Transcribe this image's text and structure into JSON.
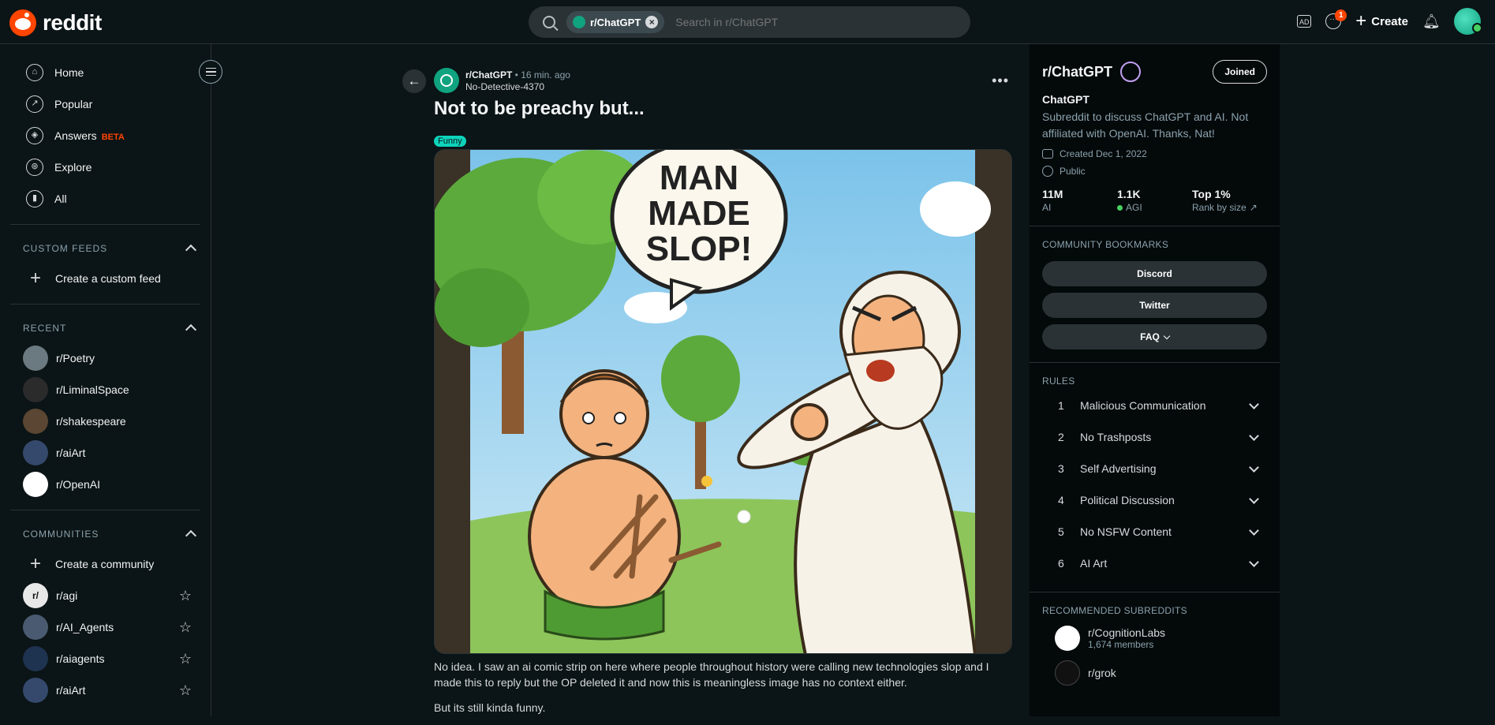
{
  "app": {
    "logo_text": "reddit",
    "brand_color": "#ff4500"
  },
  "search": {
    "chip_label": "r/ChatGPT",
    "placeholder": "Search in r/ChatGPT"
  },
  "header": {
    "notification_count": "1",
    "create_label": "Create",
    "icons": [
      "advertise-icon",
      "chat-icon",
      "plus-icon",
      "bell-icon",
      "avatar"
    ]
  },
  "sidebar": {
    "nav": [
      {
        "label": "Home",
        "icon": "home-icon"
      },
      {
        "label": "Popular",
        "icon": "popular-icon"
      },
      {
        "label": "Answers",
        "badge": "BETA",
        "icon": "answers-icon"
      },
      {
        "label": "Explore",
        "icon": "explore-icon"
      },
      {
        "label": "All",
        "icon": "all-icon"
      }
    ],
    "custom_feeds": {
      "title": "CUSTOM FEEDS",
      "create_label": "Create a custom feed"
    },
    "recent": {
      "title": "RECENT",
      "items": [
        "r/Poetry",
        "r/LiminalSpace",
        "r/shakespeare",
        "r/aiArt",
        "r/OpenAI"
      ]
    },
    "communities": {
      "title": "COMMUNITIES",
      "create_label": "Create a community",
      "items": [
        "r/agi",
        "r/AI_Agents",
        "r/aiagents",
        "r/aiArt"
      ]
    }
  },
  "post": {
    "subreddit": "r/ChatGPT",
    "time": "16 min. ago",
    "author": "No-Detective-4370",
    "title": "Not to be preachy but...",
    "flair": "Funny",
    "flair_color": "#0dd3bb",
    "speech_bubble": [
      "MAN",
      "MADE",
      "SLOP!"
    ],
    "body": [
      "No idea. I saw an ai comic strip on here where people throughout history were calling new technologies slop and I made this to reply but the OP deleted it and now this is meaningless image has no context either.",
      "But its still kinda funny."
    ]
  },
  "community": {
    "name": "r/ChatGPT",
    "joined_label": "Joined",
    "display_name": "ChatGPT",
    "description": "Subreddit to discuss ChatGPT and AI. Not affiliated with OpenAI. Thanks, Nat!",
    "created": "Created Dec 1, 2022",
    "visibility": "Public",
    "stats": [
      {
        "value": "11M",
        "label": "AI"
      },
      {
        "value": "1.1K",
        "label": "AGI"
      },
      {
        "value": "Top 1%",
        "label": "Rank by size"
      }
    ],
    "bookmarks_title": "COMMUNITY BOOKMARKS",
    "bookmarks": [
      "Discord",
      "Twitter",
      "FAQ"
    ],
    "rules_title": "RULES",
    "rules": [
      {
        "num": "1",
        "text": "Malicious Communication"
      },
      {
        "num": "2",
        "text": "No Trashposts"
      },
      {
        "num": "3",
        "text": "Self Advertising"
      },
      {
        "num": "4",
        "text": "Political Discussion"
      },
      {
        "num": "5",
        "text": "No NSFW Content"
      },
      {
        "num": "6",
        "text": "AI Art"
      }
    ],
    "recommended_title": "RECOMMENDED SUBREDDITS",
    "recommended": [
      {
        "name": "r/CognitionLabs",
        "members": "1,674 members"
      },
      {
        "name": "r/grok",
        "members": ""
      }
    ]
  }
}
